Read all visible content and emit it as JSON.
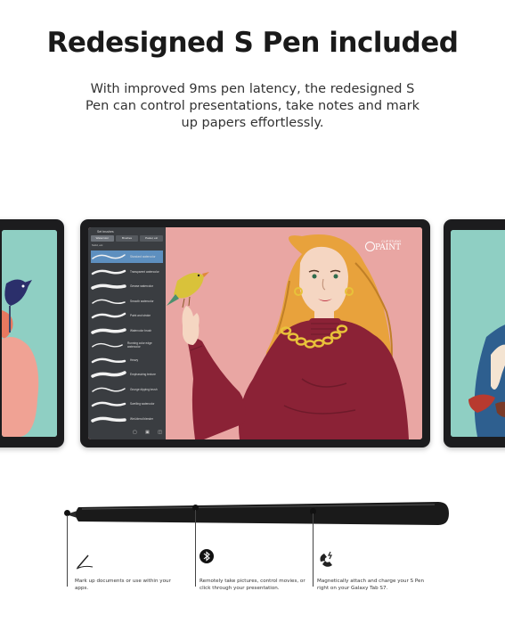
{
  "headline": "Redesigned S Pen included",
  "subtext": "With improved 9ms pen latency, the redesigned S Pen can control presentations, take notes and mark up papers effortlessly.",
  "screen_app": {
    "panel_title": "Set brushes",
    "tabs": [
      "Watercolor",
      "Brushes",
      "Pastel, etc"
    ],
    "sublabel": "Solid, etc",
    "brushes": [
      "Standard watercolor",
      "Transparent watercolor",
      "Grease watercolor",
      "Smooth watercolor",
      "Paint and stroke",
      "Watercolor brush",
      "Running color edge watercolor",
      "Heavy",
      "Emphasizing texture",
      "Grunge dipping brush",
      "Swelling watercolor",
      "Wet-blend blender"
    ],
    "logo_small": "CLIP STUDIO",
    "logo_big": "PAINT"
  },
  "features": [
    {
      "icon": "pen-stroke-icon",
      "text": "Mark up documents or use within your apps."
    },
    {
      "icon": "bluetooth-icon",
      "text": "Remotely take pictures, control movies, or click through your presentation."
    },
    {
      "icon": "magnet-icon",
      "text": "Magnetically attach and charge your S Pen right on your Galaxy Tab S7."
    }
  ],
  "colors": {
    "screen_bg": "#e9a6a3",
    "sweater": "#8b2236",
    "hair": "#e8a23c",
    "bird": "#d9c23a",
    "tablet_frame": "#1c1c1e",
    "pen": "#1a1a1a"
  }
}
